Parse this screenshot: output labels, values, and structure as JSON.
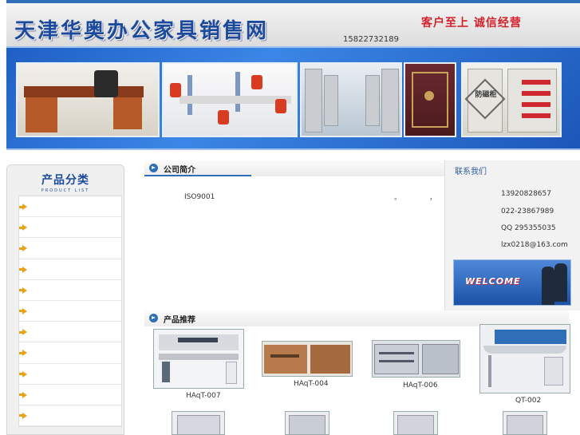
{
  "header": {
    "site_title": "天津华奥办公家具销售网",
    "slogan": "客户至上 诚信经营",
    "phone": "15822732189"
  },
  "banner": {
    "safe_label": "防磁柜"
  },
  "sidebar": {
    "title": "产品分类",
    "subtitle": "PRODUCT LIST",
    "item_count": 11
  },
  "about": {
    "title": "公司简介",
    "text": "ISO9001",
    "dot1": "。",
    "dot2": "，"
  },
  "contact": {
    "title": "联系我们",
    "phone1": "13920828657",
    "phone2": "022-23867989",
    "qq": "QQ 295355035",
    "email": "lzx0218@163.com",
    "welcome": "WELCOME"
  },
  "products": {
    "title": "产品推荐",
    "items": [
      {
        "label": "HAqT-007"
      },
      {
        "label": "HAqT-004"
      },
      {
        "label": "HAqT-006"
      },
      {
        "label": "QT-002"
      }
    ]
  },
  "colors": {
    "accent": "#2f6fb8",
    "title_blue": "#1b4a9c",
    "slogan_red": "#d4202a",
    "arrow": "#e8a317"
  }
}
